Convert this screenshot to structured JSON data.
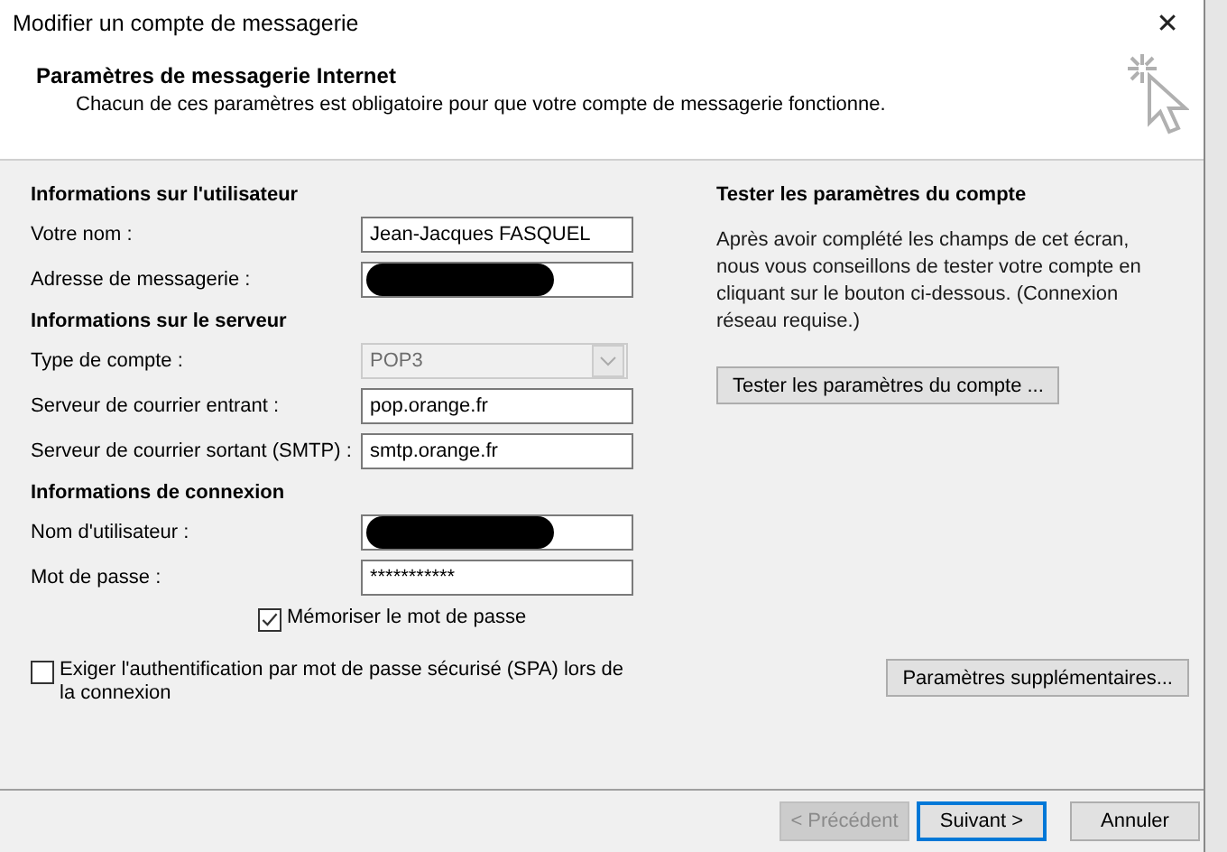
{
  "window": {
    "title": "Modifier un compte de messagerie",
    "close": "✕"
  },
  "header": {
    "title": "Paramètres de messagerie Internet",
    "subtitle": "Chacun de ces paramètres est obligatoire pour que votre compte de messagerie fonctionne."
  },
  "sections": [
    {
      "heading": "Informations sur l'utilisateur",
      "fields": [
        {
          "kind": "text",
          "label": "Votre nom :",
          "value": "Jean-Jacques FASQUEL",
          "redacted": false
        },
        {
          "kind": "text",
          "label": "Adresse de messagerie :",
          "redacted": true
        }
      ]
    },
    {
      "heading": "Informations sur le serveur",
      "fields": [
        {
          "kind": "select",
          "label": "Type de compte :",
          "value": "POP3",
          "disabled": true
        },
        {
          "kind": "text",
          "label": "Serveur de courrier entrant :",
          "value": "pop.orange.fr",
          "redacted": false
        },
        {
          "kind": "text",
          "label": "Serveur de courrier sortant (SMTP) :",
          "value": "smtp.orange.fr",
          "redacted": false
        }
      ]
    },
    {
      "heading": "Informations de connexion",
      "fields": [
        {
          "kind": "text",
          "label": "Nom d'utilisateur :",
          "redacted": true
        },
        {
          "kind": "text",
          "label": "Mot de passe :",
          "value": "***********",
          "redacted": false
        }
      ]
    }
  ],
  "remember_password": {
    "label": "Mémoriser le mot de passe",
    "checked": true
  },
  "spa": {
    "label": "Exiger l'authentification par mot de passe sécurisé (SPA) lors de la connexion",
    "checked": false
  },
  "test": {
    "heading": "Tester les paramètres du compte",
    "text": "Après avoir complété les champs de cet écran, nous vous conseillons de tester votre compte en cliquant sur le bouton ci-dessous. (Connexion réseau requise.)",
    "button": "Tester les paramètres du compte ..."
  },
  "more_settings_button": "Paramètres supplémentaires...",
  "buttons": [
    {
      "label": "< Précédent",
      "disabled": true,
      "default": false
    },
    {
      "label": "Suivant >",
      "disabled": false,
      "default": true
    },
    {
      "label": "Annuler",
      "disabled": false,
      "default": false
    }
  ]
}
